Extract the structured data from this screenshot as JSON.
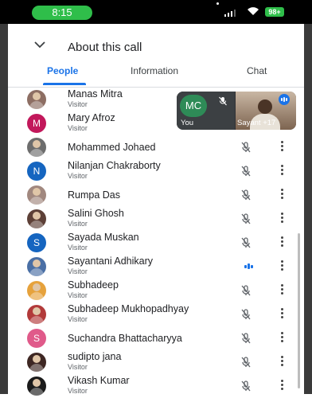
{
  "status_bar": {
    "time": "8:15",
    "battery": "98+"
  },
  "header": {
    "title": "About this call"
  },
  "tabs": [
    {
      "label": "People",
      "active": true
    },
    {
      "label": "Information",
      "active": false
    },
    {
      "label": "Chat",
      "active": false
    }
  ],
  "self_tile": {
    "initials": "MC",
    "label": "You"
  },
  "other_tile": {
    "label": "Sayant +17"
  },
  "participants": [
    {
      "name": "Manas Mitra",
      "role": "Visitor",
      "avatar_type": "photo",
      "avatar_color": "#8d6e63"
    },
    {
      "name": "Mary Afroz",
      "role": "Visitor",
      "avatar_type": "letter",
      "initial": "M",
      "avatar_color": "#c2185b"
    },
    {
      "name": "Mohammed Johaed",
      "role": "",
      "avatar_type": "photo",
      "avatar_color": "#6d6d6d",
      "mic": "muted"
    },
    {
      "name": "Nilanjan Chakraborty",
      "role": "Visitor",
      "avatar_type": "letter",
      "initial": "N",
      "avatar_color": "#1565c0",
      "mic": "muted"
    },
    {
      "name": "Rumpa Das",
      "role": "",
      "avatar_type": "photo",
      "avatar_color": "#a1887f",
      "mic": "muted"
    },
    {
      "name": "Salini Ghosh",
      "role": "Visitor",
      "avatar_type": "photo",
      "avatar_color": "#5d4037",
      "mic": "muted"
    },
    {
      "name": "Sayada Muskan",
      "role": "Visitor",
      "avatar_type": "letter",
      "initial": "S",
      "avatar_color": "#1565c0",
      "mic": "muted"
    },
    {
      "name": "Sayantani Adhikary",
      "role": "Visitor",
      "avatar_type": "photo",
      "avatar_color": "#4a6fa5",
      "mic": "speaking"
    },
    {
      "name": "Subhadeep",
      "role": "Visitor",
      "avatar_type": "photo",
      "avatar_color": "#e6a23c",
      "mic": "muted"
    },
    {
      "name": "Subhadeep Mukhopadhyay",
      "role": "Visitor",
      "avatar_type": "photo",
      "avatar_color": "#b23a3a",
      "mic": "muted"
    },
    {
      "name": "Suchandra Bhattacharyya",
      "role": "",
      "avatar_type": "letter",
      "initial": "S",
      "avatar_color": "#e05a8a",
      "mic": "muted"
    },
    {
      "name": "sudipto jana",
      "role": "Visitor",
      "avatar_type": "photo",
      "avatar_color": "#3e2723",
      "mic": "muted"
    },
    {
      "name": "Vikash Kumar",
      "role": "Visitor",
      "avatar_type": "photo",
      "avatar_color": "#1b1b1b",
      "mic": "muted"
    }
  ]
}
